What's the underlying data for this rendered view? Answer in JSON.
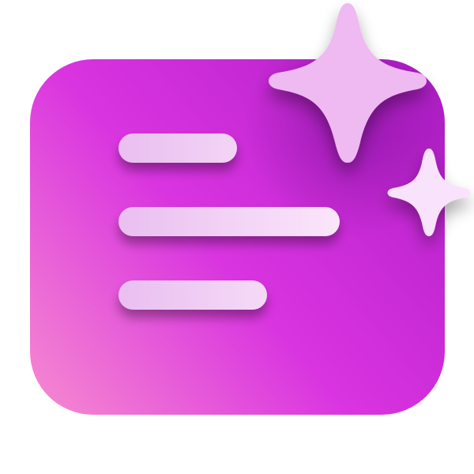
{
  "icon": {
    "name": "ai-summary-text-sparkle-icon",
    "colors": {
      "card_gradient_start": "#f68ad0",
      "card_gradient_mid": "#d934e0",
      "card_gradient_end": "#b11ec8",
      "line_fill_light": "#f6dcf6",
      "line_fill_dark": "#e6b6ef",
      "sparkle_large": "#efb9f1",
      "sparkle_small": "#f9e2fb",
      "background": "#ffffff"
    },
    "text_lines": 3,
    "sparkles": 2
  }
}
